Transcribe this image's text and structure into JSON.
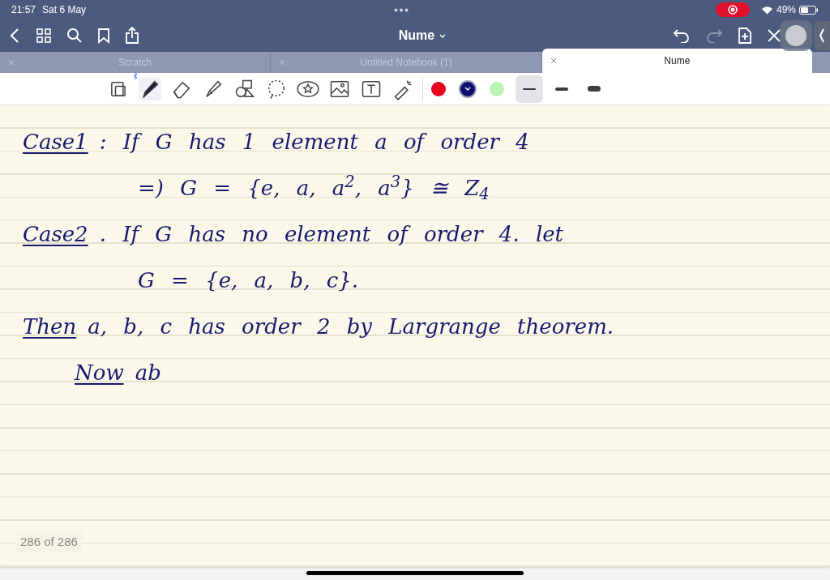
{
  "status_bar": {
    "time": "21:57",
    "date": "Sat 6 May",
    "battery": "49%",
    "recording": true
  },
  "nav": {
    "title": "Nume"
  },
  "tabs": [
    {
      "label": "Scratch",
      "selected": false
    },
    {
      "label": "Untitled Notebook (1)",
      "selected": false
    },
    {
      "label": "Nume",
      "selected": true
    }
  ],
  "tools": [
    {
      "kind": "page-view",
      "selected": false
    },
    {
      "kind": "pen",
      "selected": true
    },
    {
      "kind": "eraser",
      "selected": false
    },
    {
      "kind": "highlighter",
      "selected": false
    },
    {
      "kind": "shapes",
      "selected": false
    },
    {
      "kind": "lasso",
      "selected": false
    },
    {
      "kind": "sticker",
      "selected": false
    },
    {
      "kind": "image",
      "selected": false
    },
    {
      "kind": "text",
      "selected": false
    },
    {
      "kind": "laser",
      "selected": false
    }
  ],
  "colors": [
    {
      "color": "#e8001c",
      "selected": false
    },
    {
      "color": "#0c0f6e",
      "selected": true
    },
    {
      "color": "#b8f5b0",
      "selected": false
    }
  ],
  "stroke_widths": [
    {
      "selected": true
    },
    {
      "selected": false
    },
    {
      "selected": false
    }
  ],
  "notes": [
    {
      "kind": "heading",
      "label": "Case1",
      "text": ": If G has 1 element a of order 4"
    },
    {
      "kind": "continuation",
      "text": "=) G = {e, a, a$^{2}$, a$^{3}$} ≅ Z$_{4}$"
    },
    {
      "kind": "heading",
      "label": "Case2",
      "text": ". If G has no element of order 4. let"
    },
    {
      "kind": "continuation",
      "text": "G = {e, a, b, c}."
    },
    {
      "kind": "heading",
      "label": "Then",
      "text": "a, b, c has order 2 by Largrange theorem."
    },
    {
      "kind": "step",
      "label": "Now",
      "text": "ab"
    }
  ],
  "page_counter": "286 of 286"
}
